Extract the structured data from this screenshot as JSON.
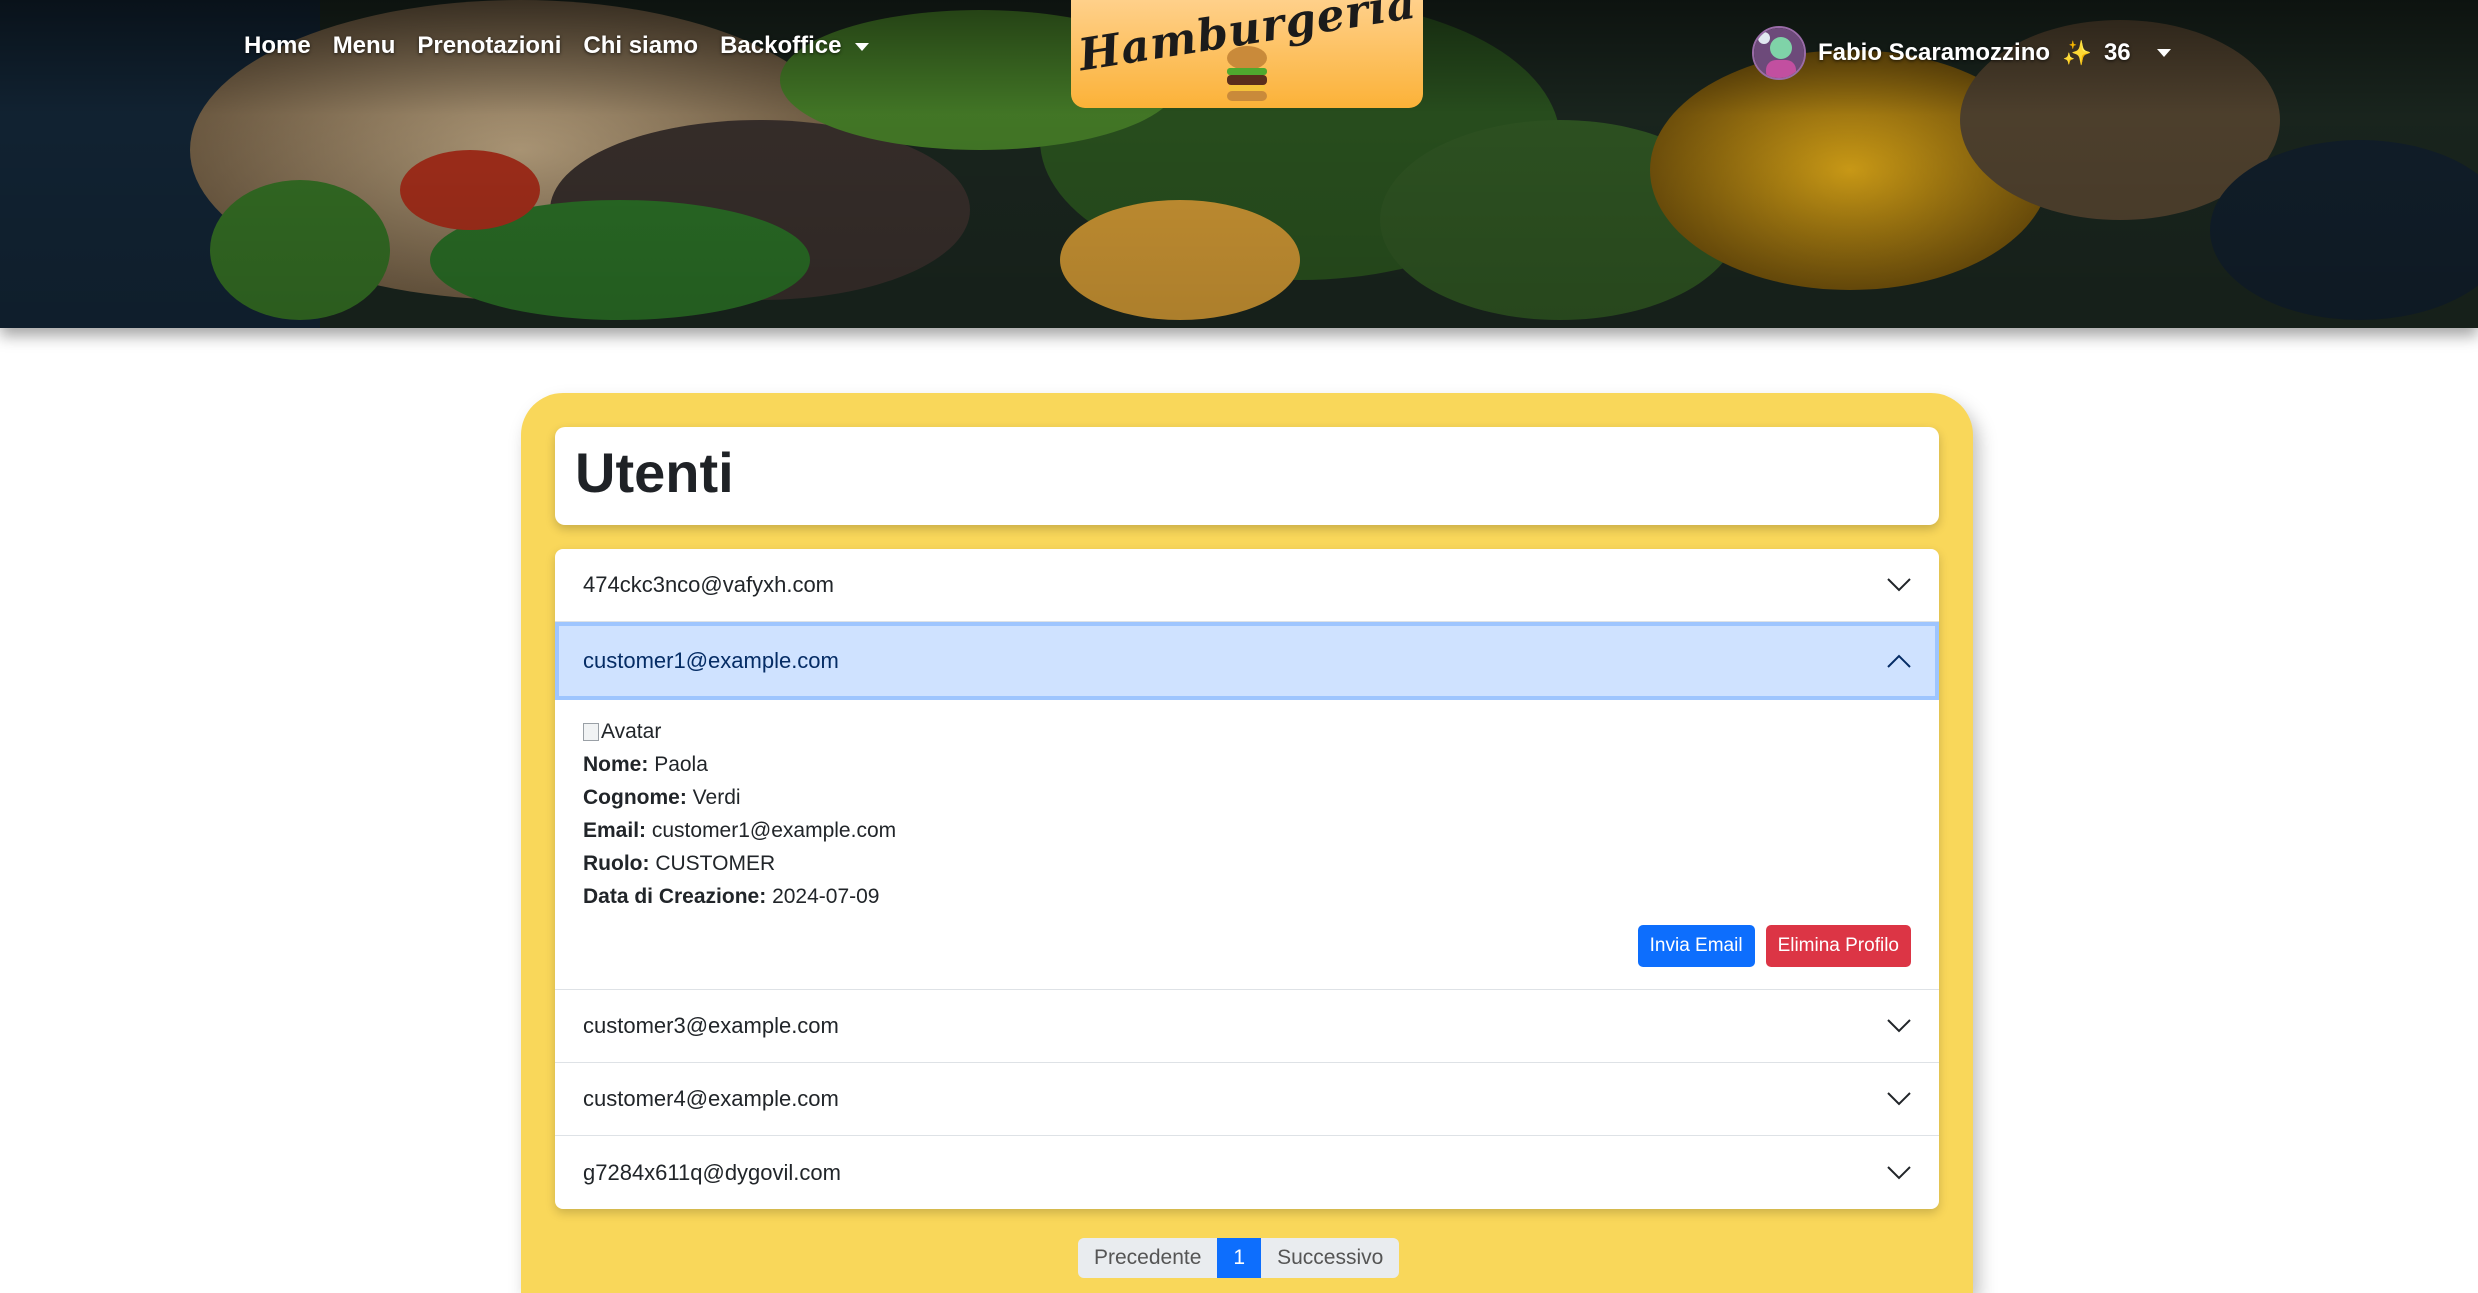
{
  "nav": {
    "home": "Home",
    "menu": "Menu",
    "prenotazioni": "Prenotazioni",
    "chi_siamo": "Chi siamo",
    "backoffice": "Backoffice"
  },
  "logo": {
    "text": "Hamburgeria"
  },
  "user": {
    "name": "Fabio Scaramozzino",
    "points_icon": "✨",
    "points": "36"
  },
  "page": {
    "title": "Utenti"
  },
  "users": [
    {
      "email": "474ckc3nco@vafyxh.com"
    },
    {
      "email": "customer1@example.com"
    },
    {
      "email": "customer3@example.com"
    },
    {
      "email": "customer4@example.com"
    },
    {
      "email": "g7284x611q@dygovil.com"
    }
  ],
  "detail": {
    "avatar_alt": "Avatar",
    "nome_label": "Nome:",
    "nome": "Paola",
    "cognome_label": "Cognome:",
    "cognome": "Verdi",
    "email_label": "Email:",
    "email": "customer1@example.com",
    "ruolo_label": "Ruolo:",
    "ruolo": "CUSTOMER",
    "data_label": "Data di Creazione:",
    "data": "2024-07-09",
    "send_email": "Invia Email",
    "delete_profile": "Elimina Profilo"
  },
  "pagination": {
    "prev": "Precedente",
    "current": "1",
    "next": "Successivo"
  },
  "colors": {
    "panel": "#f9d75a",
    "primary": "#0d6efd",
    "danger": "#dc3545",
    "logo": "#fbb238"
  }
}
